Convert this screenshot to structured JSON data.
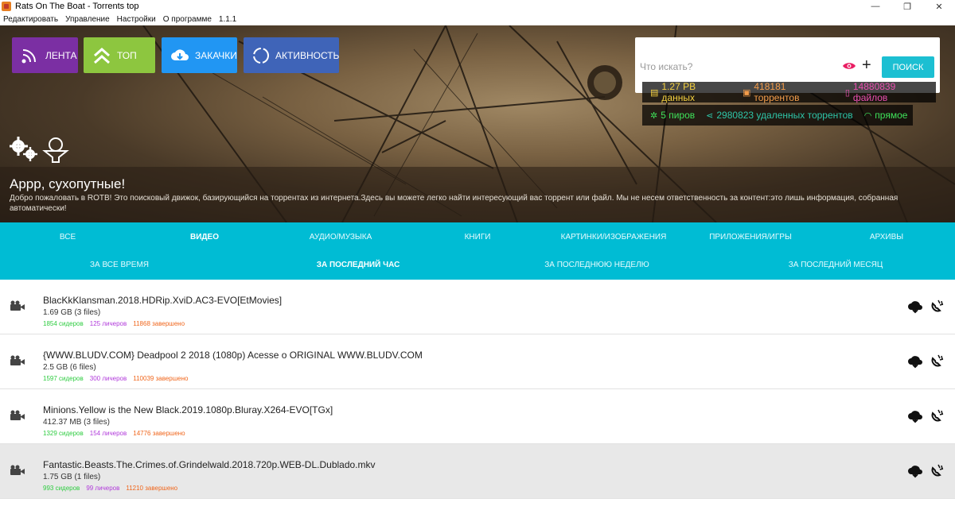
{
  "window": {
    "title": "Rats On The Boat - Torrents top",
    "controls": [
      "—",
      "❐",
      "✕"
    ]
  },
  "menu": [
    "Редактировать",
    "Управление",
    "Настройки",
    "О программе",
    "1.1.1"
  ],
  "nav": {
    "feed": "ЛЕНТА",
    "top": "ТОП",
    "downloads": "ЗАКАЧКИ",
    "activity": "АКТИВНОСТЬ"
  },
  "search": {
    "placeholder": "Что искать?",
    "button": "ПОИСК"
  },
  "stats": {
    "data": "1.27 PB данных",
    "torrents": "418181 торрентов",
    "files": "14880839 файлов",
    "peers": "5 пиров",
    "removed": "2980823 удаленных торрентов",
    "mode": "прямое"
  },
  "welcome": {
    "title": "Аррр, сухопутные!",
    "text": "Добро пожаловать в ROTB! Это поисковый движок, базирующийся на торрентах из интернета.Здесь вы можете легко найти интересующий вас торрент или файл. Мы не несем ответственность за контент:это лишь информация, собранная автоматически!"
  },
  "categories": [
    "ВСЕ",
    "ВИДЕО",
    "АУДИО/МУЗЫКА",
    "КНИГИ",
    "КАРТИНКИ/ИЗОБРАЖЕНИЯ",
    "ПРИЛОЖЕНИЯ/ИГРЫ",
    "АРХИВЫ"
  ],
  "periods": [
    "ЗА ВСЕ ВРЕМЯ",
    "ЗА ПОСЛЕДНИЙ ЧАС",
    "ЗА ПОСЛЕДНЮЮ НЕДЕЛЮ",
    "ЗА ПОСЛЕДНИЙ МЕСЯЦ"
  ],
  "active_category": "ВИДЕО",
  "active_period": "ЗА ПОСЛЕДНИЙ ЧАС",
  "torrents": [
    {
      "name": "BlacKkKlansman.2018.HDRip.XviD.AC3-EVO[EtMovies]",
      "size": "1.69 GB (3 files)",
      "seeders": "1854 сидеров",
      "leechers": "125 личеров",
      "completed": "11868 завершено"
    },
    {
      "name": "{WWW.BLUDV.COM} Deadpool 2 2018 (1080p) Acesse o ORIGINAL WWW.BLUDV.COM",
      "size": "2.5 GB (6 files)",
      "seeders": "1597 сидеров",
      "leechers": "300 личеров",
      "completed": "110039 завершено"
    },
    {
      "name": "Minions.Yellow is the New Black.2019.1080p.Bluray.X264-EVO[TGx]",
      "size": "412.37 MB (3 files)",
      "seeders": "1329 сидеров",
      "leechers": "154 личеров",
      "completed": "14776 завершено"
    },
    {
      "name": "Fantastic.Beasts.The.Crimes.of.Grindelwald.2018.720p.WEB-DL.Dublado.mkv",
      "size": "1.75 GB (1 files)",
      "seeders": "993 сидеров",
      "leechers": "99 личеров",
      "completed": "11210 завершено"
    }
  ],
  "colors": {
    "feed": "#7b2fa3",
    "top": "#8dc63f",
    "downloads": "#2196f3",
    "activity": "#3f64b8",
    "accent": "#00bcd4",
    "seeders": "#2ecc40",
    "leechers": "#b13adb",
    "completed": "#f0661c"
  }
}
